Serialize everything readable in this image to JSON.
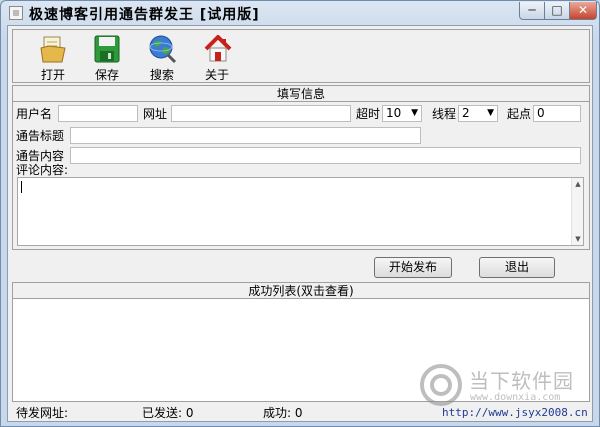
{
  "window": {
    "title": "极速博客引用通告群发王 [试用版]",
    "controls": {
      "minimize": "─",
      "maximize": "□",
      "close": "✕"
    }
  },
  "toolbar": {
    "items": [
      {
        "label": "打开",
        "icon": "folder-open-icon"
      },
      {
        "label": "保存",
        "icon": "save-disk-icon"
      },
      {
        "label": "搜索",
        "icon": "globe-search-icon"
      },
      {
        "label": "关于",
        "icon": "home-icon"
      }
    ]
  },
  "info": {
    "header": "填写信息",
    "username_label": "用户名",
    "username_value": "",
    "url_label": "网址",
    "url_value": "",
    "timeout_label": "超时",
    "timeout_value": "10",
    "threads_label": "线程",
    "threads_value": "2",
    "start_label": "起点",
    "start_value": "0",
    "notice_title_label": "通告标题",
    "notice_title_value": "",
    "notice_content_label": "通告内容",
    "notice_content_value": "",
    "comment_label": "评论内容:",
    "comment_value": ""
  },
  "actions": {
    "start_label": "开始发布",
    "exit_label": "退出"
  },
  "success_list": {
    "header": "成功列表(双击查看)"
  },
  "status": {
    "pending_label": "待发网址:",
    "sent_label": "已发送: 0",
    "success_label": "成功: 0",
    "link": "http://www.jsyx2008.cn"
  },
  "watermark": {
    "text": "当下软件园",
    "sub": "www.downxia.com"
  },
  "colors": {
    "accent": "#6f8bad",
    "link": "#1f3a93"
  }
}
